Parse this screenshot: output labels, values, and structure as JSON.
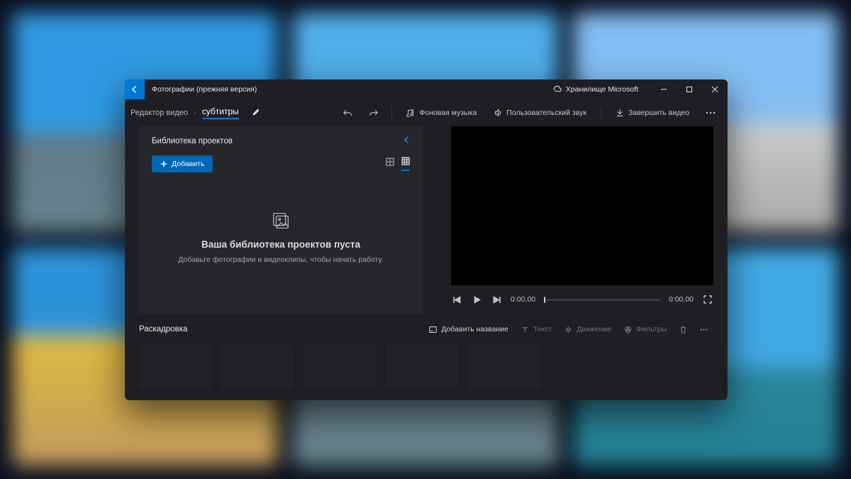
{
  "titlebar": {
    "app_title": "Фотографии (прежняя версия)",
    "cloud_label": "Хранилище Microsoft"
  },
  "toolbar": {
    "crumb_root": "Редактор видео",
    "project_name": "субтитры",
    "bg_music": "Фоновая музыка",
    "custom_audio": "Пользовательский звук",
    "finish": "Завершить видео"
  },
  "library": {
    "title": "Библиотека проектов",
    "add": "Добавить",
    "empty_title": "Ваша библиотека проектов пуста",
    "empty_sub": "Добавьте фотографии и видеоклипы, чтобы начать работу."
  },
  "preview": {
    "time_current": "0:00,00",
    "time_total": "0:00,00"
  },
  "storyboard": {
    "title": "Раскадровка",
    "add_title": "Добавить название",
    "text": "Текст",
    "motion": "Движение",
    "filters": "Фильтры"
  }
}
